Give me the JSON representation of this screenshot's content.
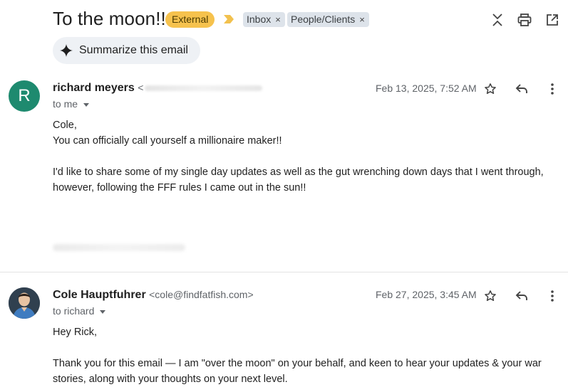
{
  "subject": "To the moon!!",
  "badge": "External",
  "labels": [
    {
      "name": "Inbox",
      "remove": "×"
    },
    {
      "name": "People/Clients",
      "remove": "×"
    }
  ],
  "toolbar_icons": [
    "expand-collapse-icon",
    "print-icon",
    "open-in-new-window-icon"
  ],
  "summarize": {
    "label": "Summarize this email",
    "icon": "sparkle-icon"
  },
  "messages": [
    {
      "avatar_letter": "R",
      "avatar_color": "#1e8a6f",
      "sender_name": "richard meyers",
      "sender_email_prefix": "<",
      "recipient": "to me",
      "date": "Feb 13, 2025, 7:52 AM",
      "body": [
        "Cole,",
        "You can officially call yourself a millionaire maker!!",
        "",
        "I'd like to share some of my single day updates as well as the gut wrenching down days that I went through,",
        "however, following the FFF rules I came out in the sun!!"
      ]
    },
    {
      "avatar_letter": "",
      "sender_name": "Cole Hauptfuhrer",
      "sender_email": "<cole@findfatfish.com>",
      "recipient": "to richard",
      "date": "Feb 27, 2025, 3:45 AM",
      "body": [
        "Hey Rick,",
        "",
        "Thank you for this email — I am \"over the moon\" on your behalf, and keen to hear your updates & your war",
        "stories, along with your thoughts on your next level."
      ]
    }
  ],
  "colors": {
    "badge_external": "#f6c24d",
    "importance_marker": "#f2c14e",
    "label_chip": "#dde3ea",
    "summarize_bg": "#eef1f5"
  }
}
